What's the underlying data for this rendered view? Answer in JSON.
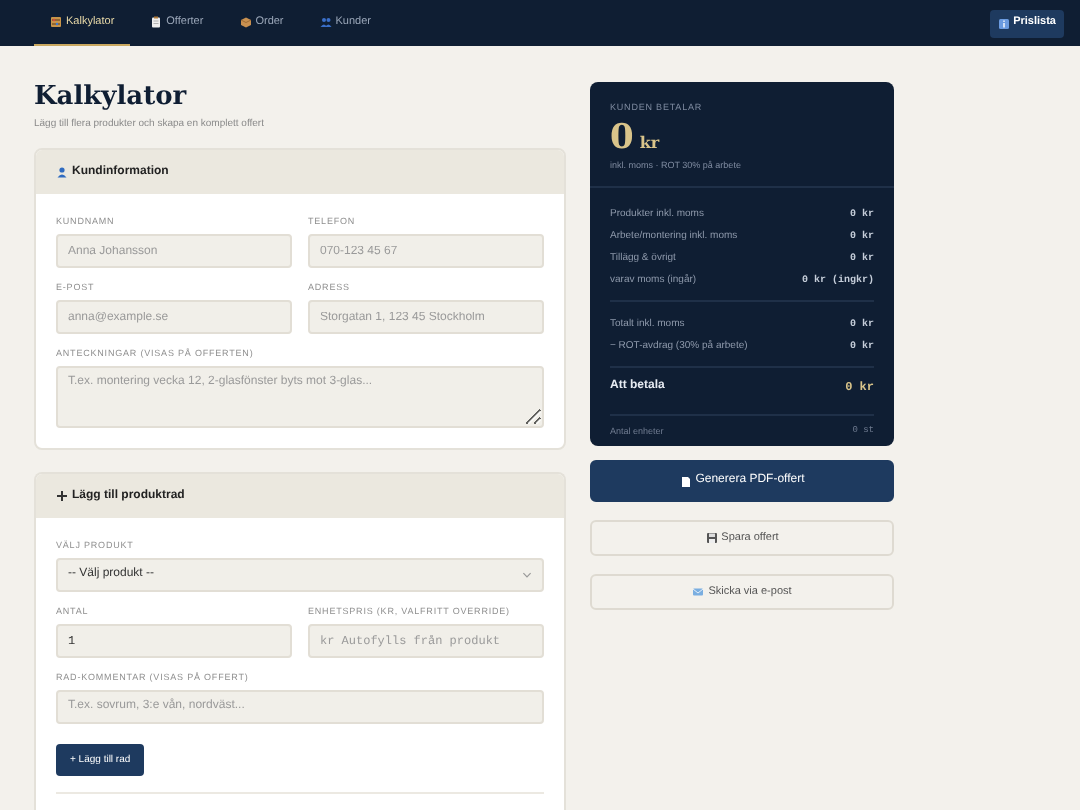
{
  "nav": {
    "tabs": [
      {
        "label": "Kalkylator",
        "selected": true
      },
      {
        "label": "Offerter",
        "selected": false
      },
      {
        "label": "Order",
        "selected": false
      },
      {
        "label": "Kunder",
        "selected": false
      }
    ],
    "button": "Prislista"
  },
  "page": {
    "title": "Kalkylator",
    "subtitle": "Lägg till flera produkter och skapa en komplett offert"
  },
  "customer_card": {
    "title": "Kundinformation",
    "fields": [
      {
        "label": "KUNDNAMN",
        "placeholder": "Anna Johansson",
        "kind": "text"
      },
      {
        "label": "TELEFON",
        "placeholder": "070-123 45 67",
        "kind": "text"
      },
      {
        "label": "E-POST",
        "placeholder": "anna@example.se",
        "kind": "text"
      },
      {
        "label": "ADRESS",
        "placeholder": "Storgatan 1, 123 45 Stockholm",
        "kind": "text"
      },
      {
        "label": "ANTECKNINGAR (VISAS PÅ OFFERTEN)",
        "placeholder": "T.ex. montering vecka 12, 2-glasfönster byts mot 3-glas...",
        "kind": "textarea"
      }
    ]
  },
  "product_card": {
    "title": "Lägg till produktrad",
    "fields": [
      {
        "label": "VÄLJ PRODUKT",
        "value": "-- Välj produkt --",
        "kind": "select"
      },
      {
        "label": "ANTAL",
        "value": "1",
        "kind": "number"
      },
      {
        "label": "ENHETSPRIS (KR, VALFRITT OVERRIDE)",
        "placeholder": "kr Autofylls från produkt",
        "kind": "mono"
      },
      {
        "label": "RAD-KOMMENTAR (VISAS PÅ OFFERT)",
        "placeholder": "T.ex. sovrum, 3:e vån, nordväst...",
        "kind": "wide"
      }
    ],
    "button": "+ Lägg till rad"
  },
  "summary": {
    "caption": "KUNDEN BETALAR",
    "amount": "0",
    "currency": "kr",
    "note": "inkl. moms · ROT 30% på arbete",
    "groups": [
      [
        {
          "label": "Produkter inkl. moms",
          "value": "0 kr"
        },
        {
          "label": "Arbete/montering inkl. moms",
          "value": "0 kr"
        },
        {
          "label": "Tillägg & övrigt",
          "value": "0 kr"
        },
        {
          "label": "varav moms (ingår)",
          "value": "0 kr (ingkr)"
        }
      ],
      [
        {
          "label": "Totalt inkl. moms",
          "value": "0 kr"
        },
        {
          "label": "− ROT-avdrag (30% på arbete)",
          "value": "0 kr"
        }
      ]
    ],
    "total": {
      "label": "Att betala",
      "value": "0 kr"
    },
    "footer": {
      "label": "Antal enheter",
      "value": "0 st"
    }
  },
  "actions": [
    {
      "label": "Generera PDF-offert",
      "kind": "primary"
    },
    {
      "label": "Spara offert",
      "kind": "secondary"
    },
    {
      "label": "Skicka via e-post",
      "kind": "secondary"
    }
  ]
}
